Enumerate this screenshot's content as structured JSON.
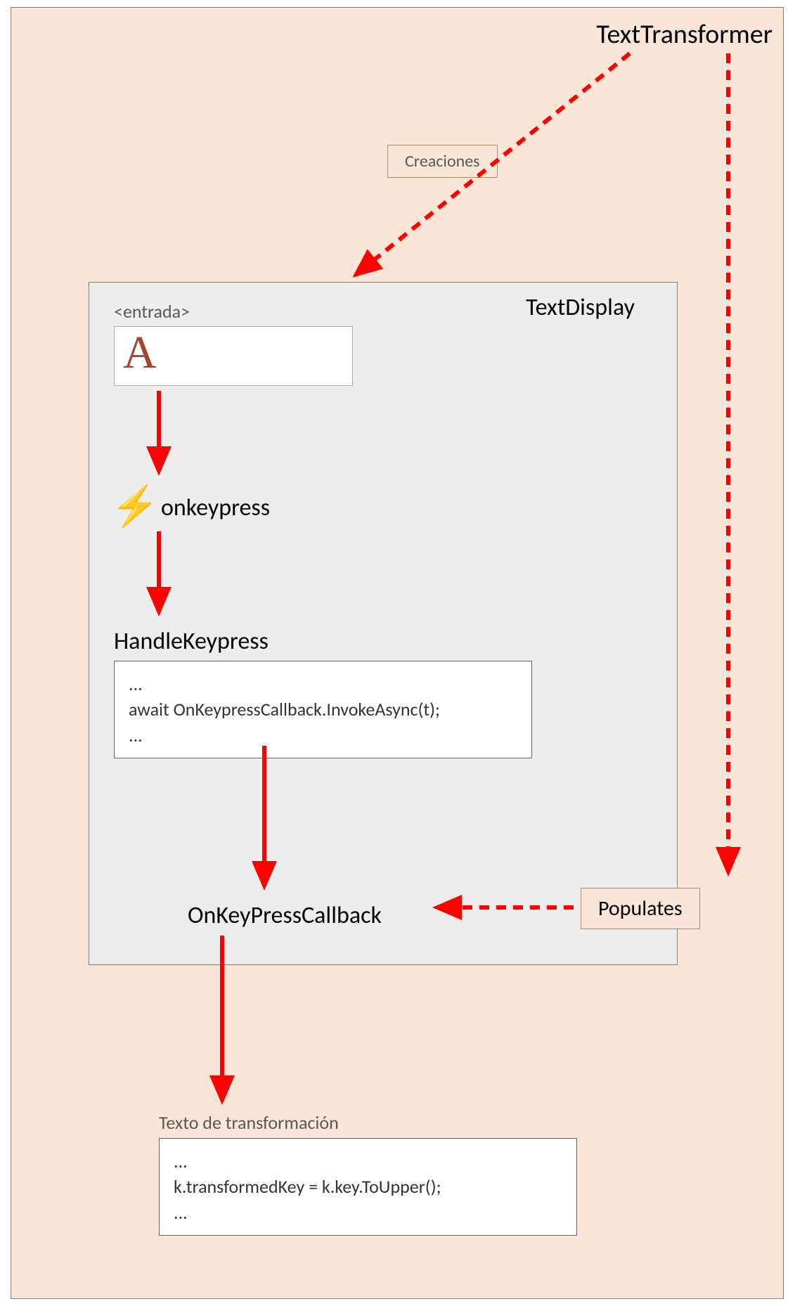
{
  "title": "TextTransformer",
  "creaciones_label": "Creaciones",
  "text_display": {
    "title": "TextDisplay",
    "entrada_label": "<entrada>",
    "input_value": "A",
    "onkeypress_label": "onkeypress",
    "handle_keypress_label": "HandleKeypress",
    "code1_line1": "...",
    "code1_line2": "await OnKeypressCallback.InvokeAsync(t);",
    "code1_line3": "...",
    "callback_label": "OnKeyPressCallback"
  },
  "populates_label": "Populates",
  "transform_label": "Texto de transformación",
  "code2_line1": "...",
  "code2_line2": "k.transformedKey = k.key.ToUpper();",
  "code2_line3": "..."
}
